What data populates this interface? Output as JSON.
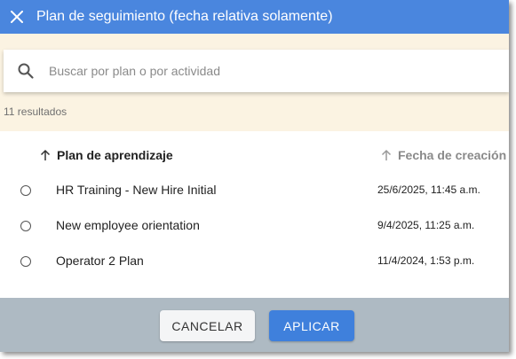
{
  "dialog": {
    "title": "Plan de seguimiento (fecha relativa solamente)"
  },
  "search": {
    "placeholder": "Buscar por plan o por actividad",
    "value": ""
  },
  "results_count": "11 resultados",
  "table": {
    "columns": [
      {
        "label": "Plan de aprendizaje",
        "sort_icon": "arrow-up-icon"
      },
      {
        "label": "Fecha de creación",
        "sort_icon": "arrow-up-icon"
      }
    ],
    "rows": [
      {
        "plan": "HR Training - New Hire Initial",
        "date": "25/6/2025, 11:45 a.m."
      },
      {
        "plan": "New employee orientation",
        "date": "9/4/2025, 11:25 a.m."
      },
      {
        "plan": "Operator 2 Plan",
        "date": "11/4/2024, 1:53 p.m."
      }
    ]
  },
  "buttons": {
    "cancel": "CANCELAR",
    "apply": "APLICAR"
  },
  "colors": {
    "header": "#4a86de",
    "search_area": "#fbf3e2",
    "footer": "#aebac3",
    "apply_button": "#3f80dc"
  }
}
